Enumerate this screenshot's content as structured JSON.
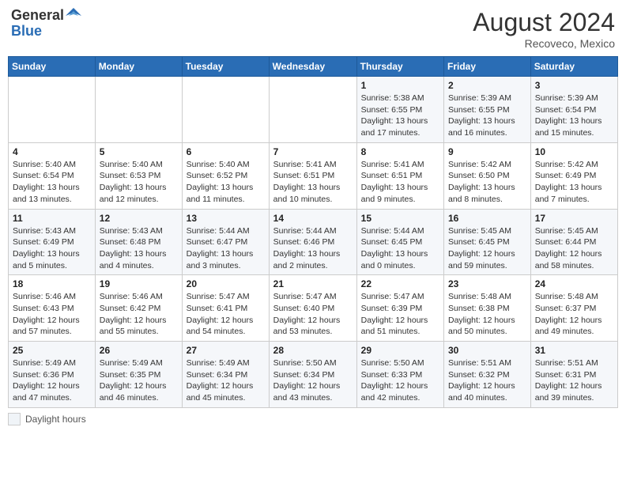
{
  "header": {
    "logo_general": "General",
    "logo_blue": "Blue",
    "month_year": "August 2024",
    "location": "Recoveco, Mexico"
  },
  "days_of_week": [
    "Sunday",
    "Monday",
    "Tuesday",
    "Wednesday",
    "Thursday",
    "Friday",
    "Saturday"
  ],
  "weeks": [
    [
      {
        "day": "",
        "info": ""
      },
      {
        "day": "",
        "info": ""
      },
      {
        "day": "",
        "info": ""
      },
      {
        "day": "",
        "info": ""
      },
      {
        "day": "1",
        "info": "Sunrise: 5:38 AM\nSunset: 6:55 PM\nDaylight: 13 hours and 17 minutes."
      },
      {
        "day": "2",
        "info": "Sunrise: 5:39 AM\nSunset: 6:55 PM\nDaylight: 13 hours and 16 minutes."
      },
      {
        "day": "3",
        "info": "Sunrise: 5:39 AM\nSunset: 6:54 PM\nDaylight: 13 hours and 15 minutes."
      }
    ],
    [
      {
        "day": "4",
        "info": "Sunrise: 5:40 AM\nSunset: 6:54 PM\nDaylight: 13 hours and 13 minutes."
      },
      {
        "day": "5",
        "info": "Sunrise: 5:40 AM\nSunset: 6:53 PM\nDaylight: 13 hours and 12 minutes."
      },
      {
        "day": "6",
        "info": "Sunrise: 5:40 AM\nSunset: 6:52 PM\nDaylight: 13 hours and 11 minutes."
      },
      {
        "day": "7",
        "info": "Sunrise: 5:41 AM\nSunset: 6:51 PM\nDaylight: 13 hours and 10 minutes."
      },
      {
        "day": "8",
        "info": "Sunrise: 5:41 AM\nSunset: 6:51 PM\nDaylight: 13 hours and 9 minutes."
      },
      {
        "day": "9",
        "info": "Sunrise: 5:42 AM\nSunset: 6:50 PM\nDaylight: 13 hours and 8 minutes."
      },
      {
        "day": "10",
        "info": "Sunrise: 5:42 AM\nSunset: 6:49 PM\nDaylight: 13 hours and 7 minutes."
      }
    ],
    [
      {
        "day": "11",
        "info": "Sunrise: 5:43 AM\nSunset: 6:49 PM\nDaylight: 13 hours and 5 minutes."
      },
      {
        "day": "12",
        "info": "Sunrise: 5:43 AM\nSunset: 6:48 PM\nDaylight: 13 hours and 4 minutes."
      },
      {
        "day": "13",
        "info": "Sunrise: 5:44 AM\nSunset: 6:47 PM\nDaylight: 13 hours and 3 minutes."
      },
      {
        "day": "14",
        "info": "Sunrise: 5:44 AM\nSunset: 6:46 PM\nDaylight: 13 hours and 2 minutes."
      },
      {
        "day": "15",
        "info": "Sunrise: 5:44 AM\nSunset: 6:45 PM\nDaylight: 13 hours and 0 minutes."
      },
      {
        "day": "16",
        "info": "Sunrise: 5:45 AM\nSunset: 6:45 PM\nDaylight: 12 hours and 59 minutes."
      },
      {
        "day": "17",
        "info": "Sunrise: 5:45 AM\nSunset: 6:44 PM\nDaylight: 12 hours and 58 minutes."
      }
    ],
    [
      {
        "day": "18",
        "info": "Sunrise: 5:46 AM\nSunset: 6:43 PM\nDaylight: 12 hours and 57 minutes."
      },
      {
        "day": "19",
        "info": "Sunrise: 5:46 AM\nSunset: 6:42 PM\nDaylight: 12 hours and 55 minutes."
      },
      {
        "day": "20",
        "info": "Sunrise: 5:47 AM\nSunset: 6:41 PM\nDaylight: 12 hours and 54 minutes."
      },
      {
        "day": "21",
        "info": "Sunrise: 5:47 AM\nSunset: 6:40 PM\nDaylight: 12 hours and 53 minutes."
      },
      {
        "day": "22",
        "info": "Sunrise: 5:47 AM\nSunset: 6:39 PM\nDaylight: 12 hours and 51 minutes."
      },
      {
        "day": "23",
        "info": "Sunrise: 5:48 AM\nSunset: 6:38 PM\nDaylight: 12 hours and 50 minutes."
      },
      {
        "day": "24",
        "info": "Sunrise: 5:48 AM\nSunset: 6:37 PM\nDaylight: 12 hours and 49 minutes."
      }
    ],
    [
      {
        "day": "25",
        "info": "Sunrise: 5:49 AM\nSunset: 6:36 PM\nDaylight: 12 hours and 47 minutes."
      },
      {
        "day": "26",
        "info": "Sunrise: 5:49 AM\nSunset: 6:35 PM\nDaylight: 12 hours and 46 minutes."
      },
      {
        "day": "27",
        "info": "Sunrise: 5:49 AM\nSunset: 6:34 PM\nDaylight: 12 hours and 45 minutes."
      },
      {
        "day": "28",
        "info": "Sunrise: 5:50 AM\nSunset: 6:34 PM\nDaylight: 12 hours and 43 minutes."
      },
      {
        "day": "29",
        "info": "Sunrise: 5:50 AM\nSunset: 6:33 PM\nDaylight: 12 hours and 42 minutes."
      },
      {
        "day": "30",
        "info": "Sunrise: 5:51 AM\nSunset: 6:32 PM\nDaylight: 12 hours and 40 minutes."
      },
      {
        "day": "31",
        "info": "Sunrise: 5:51 AM\nSunset: 6:31 PM\nDaylight: 12 hours and 39 minutes."
      }
    ]
  ],
  "legend": {
    "label": "Daylight hours"
  }
}
